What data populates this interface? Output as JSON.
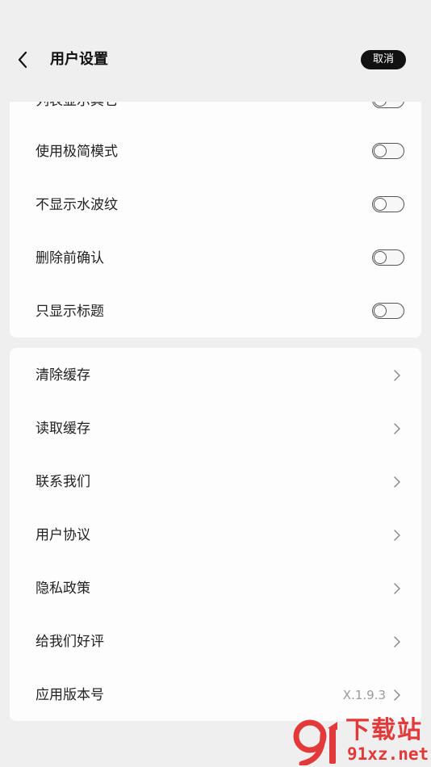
{
  "header": {
    "title": "用户设置",
    "cancel_label": "取消"
  },
  "toggle_section": {
    "partial_label": "列表显示其它",
    "items": [
      {
        "label": "使用极简模式",
        "enabled": false
      },
      {
        "label": "不显示水波纹",
        "enabled": false
      },
      {
        "label": "删除前确认",
        "enabled": false
      },
      {
        "label": "只显示标题",
        "enabled": false
      }
    ]
  },
  "link_section": {
    "items": [
      {
        "label": "清除缓存"
      },
      {
        "label": "读取缓存"
      },
      {
        "label": "联系我们"
      },
      {
        "label": "用户协议"
      },
      {
        "label": "隐私政策"
      },
      {
        "label": "给我们好评"
      },
      {
        "label": "应用版本号",
        "value": "X.1.9.3"
      }
    ]
  },
  "watermark": {
    "brand_top": "下载站",
    "brand_bottom": "91xz.net"
  }
}
